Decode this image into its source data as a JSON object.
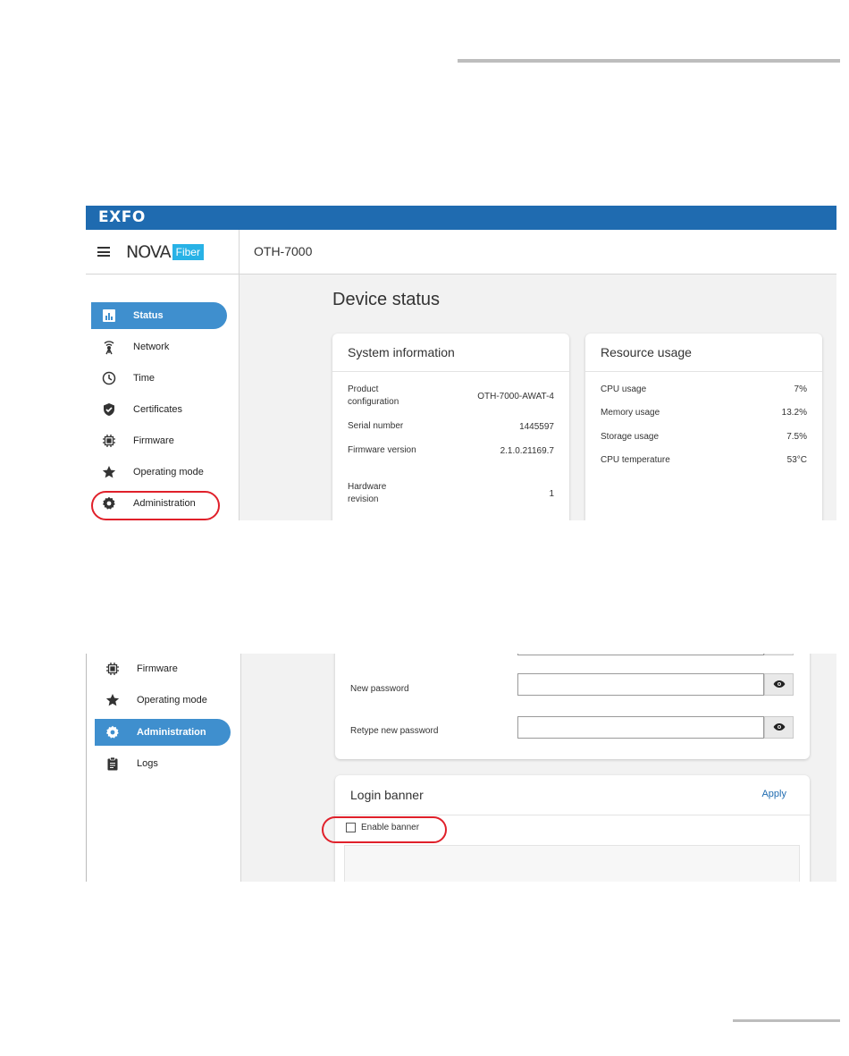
{
  "brand": {
    "logo": "EXFO",
    "product_name": "NOVA",
    "product_tag": "Fiber",
    "device": "OTH-7000"
  },
  "colors": {
    "brand_bar": "#1f6bb0",
    "active_nav": "#3f8fce",
    "highlight_circle": "#e0202a",
    "fiber_tag": "#28b2e6"
  },
  "nav1": [
    {
      "label": "Status",
      "icon": "bar-chart-icon",
      "active": true
    },
    {
      "label": "Network",
      "icon": "antenna-icon"
    },
    {
      "label": "Time",
      "icon": "clock-icon"
    },
    {
      "label": "Certificates",
      "icon": "shield-check-icon"
    },
    {
      "label": "Firmware",
      "icon": "chip-icon"
    },
    {
      "label": "Operating mode",
      "icon": "star-icon"
    },
    {
      "label": "Administration",
      "icon": "gear-icon",
      "highlighted": true
    }
  ],
  "device_status": {
    "title": "Device status",
    "system_info": {
      "title": "System information",
      "rows": [
        {
          "key": "Product configuration",
          "value": "OTH-7000-AWAT-4"
        },
        {
          "key": "Serial number",
          "value": "1445597"
        },
        {
          "key": "Firmware version",
          "value": "2.1.0.21169.7"
        },
        {
          "key": "Hardware revision",
          "value": "1"
        }
      ]
    },
    "resource_usage": {
      "title": "Resource usage",
      "rows": [
        {
          "key": "CPU usage",
          "value": "7%"
        },
        {
          "key": "Memory usage",
          "value": "13.2%"
        },
        {
          "key": "Storage usage",
          "value": "7.5%"
        },
        {
          "key": "CPU temperature",
          "value": "53°C"
        }
      ]
    }
  },
  "nav2": [
    {
      "label": "Firmware",
      "icon": "chip-icon"
    },
    {
      "label": "Operating mode",
      "icon": "star-icon"
    },
    {
      "label": "Administration",
      "icon": "gear-icon",
      "active": true
    },
    {
      "label": "Logs",
      "icon": "clipboard-icon"
    }
  ],
  "password": {
    "new_label": "New password",
    "new_value": "",
    "retype_label": "Retype new password",
    "retype_value": ""
  },
  "login_banner": {
    "title": "Login banner",
    "apply_label": "Apply",
    "enable_label": "Enable banner",
    "enabled": false,
    "text": ""
  }
}
